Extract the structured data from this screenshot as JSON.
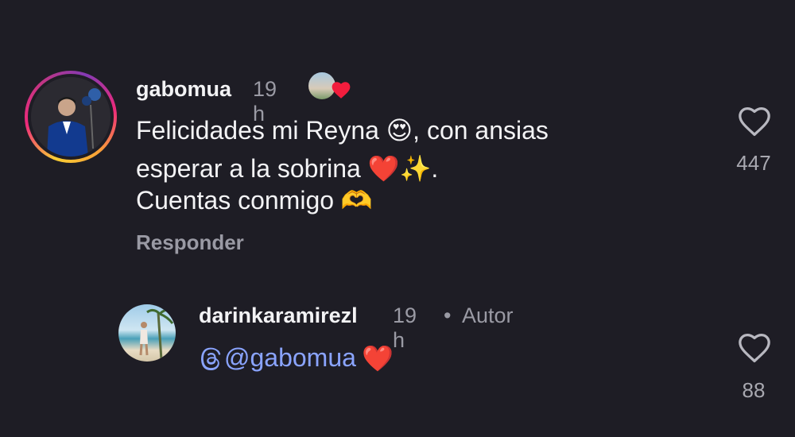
{
  "comment1": {
    "username": "gabomua",
    "time": "19 h",
    "text_line1": "Felicidades mi Reyna 😍, con ansias",
    "text_line2": "esperar a la sobrina ❤️✨.",
    "text_line3": "Cuentas conmigo 🫶",
    "reply_label": "Responder",
    "like_count": "447"
  },
  "comment2": {
    "username": "darinkaramirezl",
    "time": "19 h",
    "separator": "•",
    "author_badge": "Autor",
    "mention": "@gabomua",
    "heart": "❤️",
    "like_count": "88"
  },
  "colors": {
    "background": "#1e1d25",
    "text": "#f3f3f5",
    "muted": "#9a9aa4",
    "mention": "#8aa4ff",
    "heart": "#e0245e"
  },
  "icons": {
    "like": "heart-outline-icon",
    "creator_heart": "liked-by-creator-icon",
    "threads": "threads-icon"
  }
}
